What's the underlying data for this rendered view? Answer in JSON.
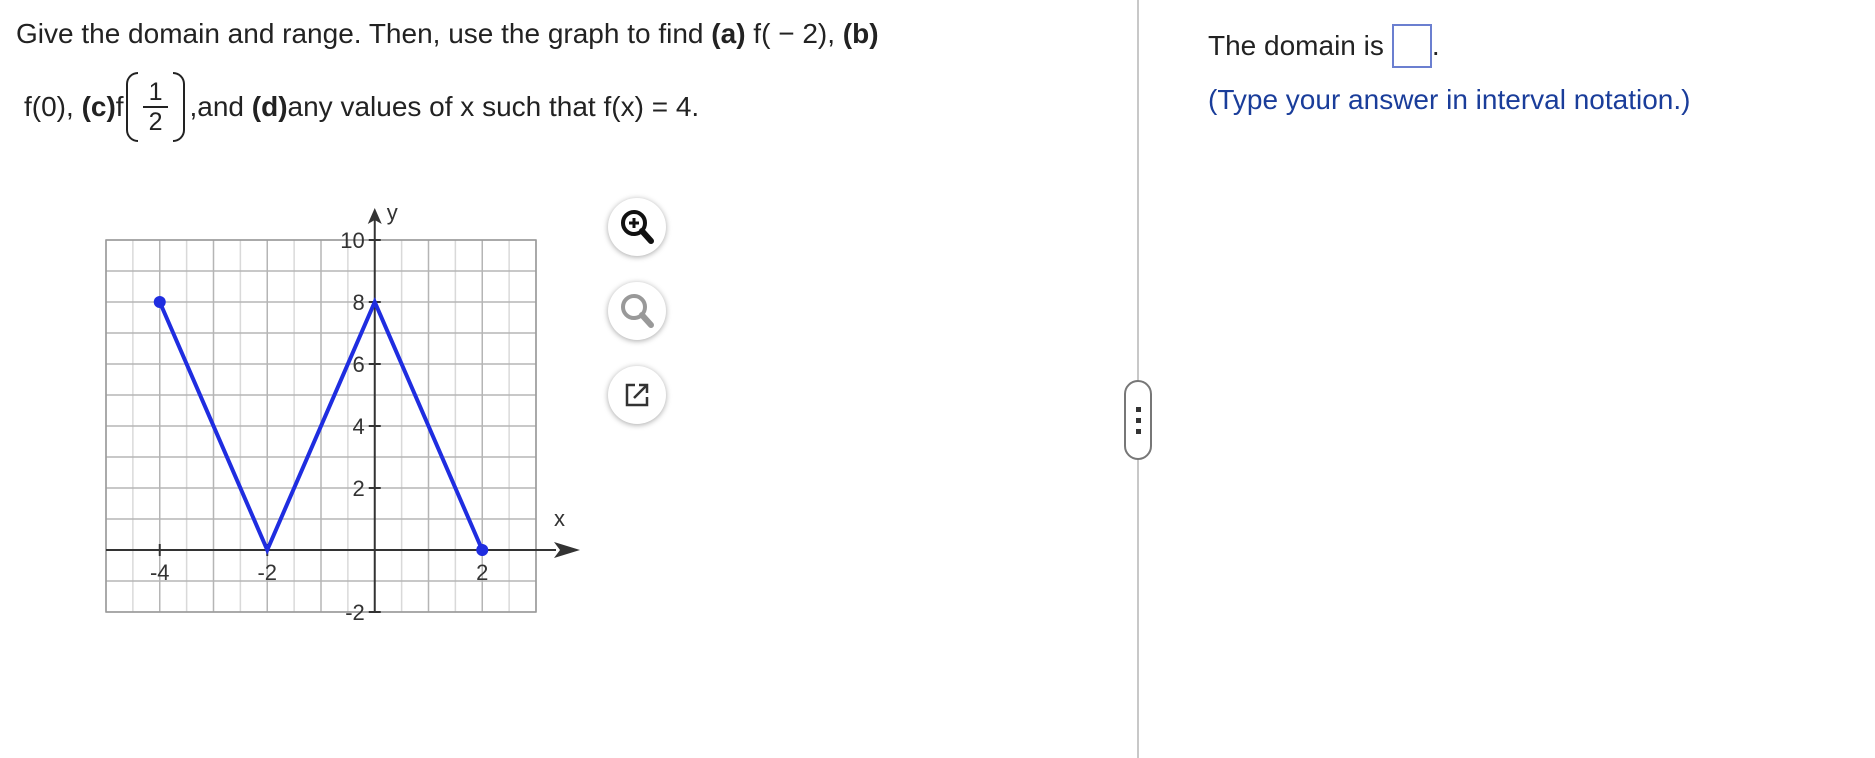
{
  "question": {
    "line1_text": "Give the domain and range. Then, use the graph to find ",
    "part_a_label": "(a)",
    "part_a_expr": " f( − 2), ",
    "part_b_label": "(b)",
    "line2_prefix": "f(0), ",
    "part_c_label": "(c)",
    "part_c_func": " f",
    "frac_num": "1",
    "frac_den": "2",
    "comma": ",",
    "and_text": " and ",
    "part_d_label": "(d)",
    "part_d_text": " any values of x such that f(x) = 4."
  },
  "graph": {
    "x_axis_label": "x",
    "y_axis_label": "y",
    "x_range": [
      -5,
      3
    ],
    "y_range": [
      -2,
      10
    ],
    "grid": true,
    "x_tick_labels": [
      "-4",
      "-2",
      "2"
    ],
    "y_tick_labels": [
      "-2",
      "2",
      "4",
      "6",
      "8",
      "10"
    ],
    "line_color": "#1f2de0",
    "points": [
      [
        -4,
        8
      ],
      [
        -2,
        0
      ],
      [
        0,
        8
      ],
      [
        2,
        0
      ]
    ]
  },
  "tools": {
    "zoom_in_icon": "zoom-in-icon",
    "zoom_out_icon": "zoom-out-icon",
    "popout_icon": "external-link-icon"
  },
  "answer_panel": {
    "prompt": "The domain is",
    "period": ".",
    "hint": "(Type your answer in interval notation.)",
    "hint_color": "#1a3d9a"
  }
}
